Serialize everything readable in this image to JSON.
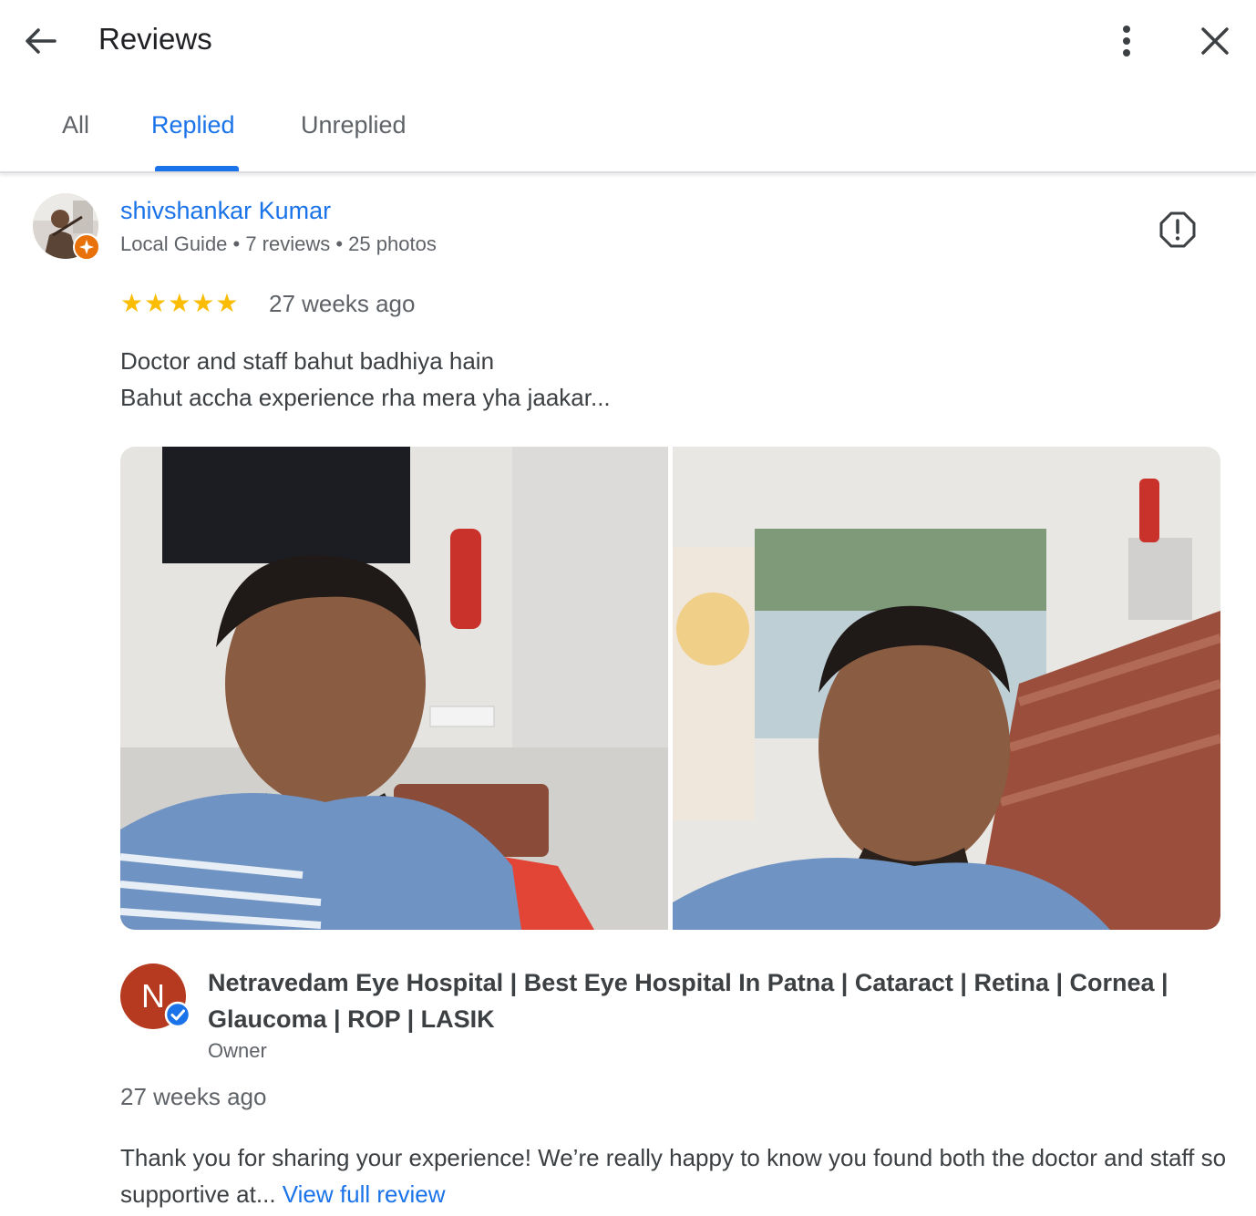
{
  "header": {
    "title": "Reviews",
    "back_icon": "arrow-left-icon",
    "more_icon": "more-vert-icon",
    "close_icon": "close-icon"
  },
  "tabs": [
    {
      "label": "All",
      "active": false
    },
    {
      "label": "Replied",
      "active": true
    },
    {
      "label": "Unreplied",
      "active": false
    }
  ],
  "review": {
    "author": "shivshankar Kumar",
    "meta": "Local Guide • 7 reviews • 25 photos",
    "rating": 5,
    "stars": "★★★★★",
    "time": "27 weeks ago",
    "text_lines": [
      "Doctor and staff bahut badhiya hain",
      "Bahut accha experience rha mera yha jaakar..."
    ],
    "photo_count": 2
  },
  "reply": {
    "avatar_letter": "N",
    "owner_name": "Netravedam Eye Hospital | Best Eye Hospital In Patna | Cataract | Retina | Cornea | Glaucoma | ROP | LASIK",
    "role": "Owner",
    "time": "27 weeks ago",
    "text": "Thank you for sharing your experience! We’re really happy to know you found both the doctor and staff so supportive at...",
    "link_label": "View full review"
  },
  "colors": {
    "accent": "#1a73e8",
    "star": "#fbbc04",
    "owner_avatar": "#b53a1f",
    "guide_badge": "#e8710a"
  }
}
